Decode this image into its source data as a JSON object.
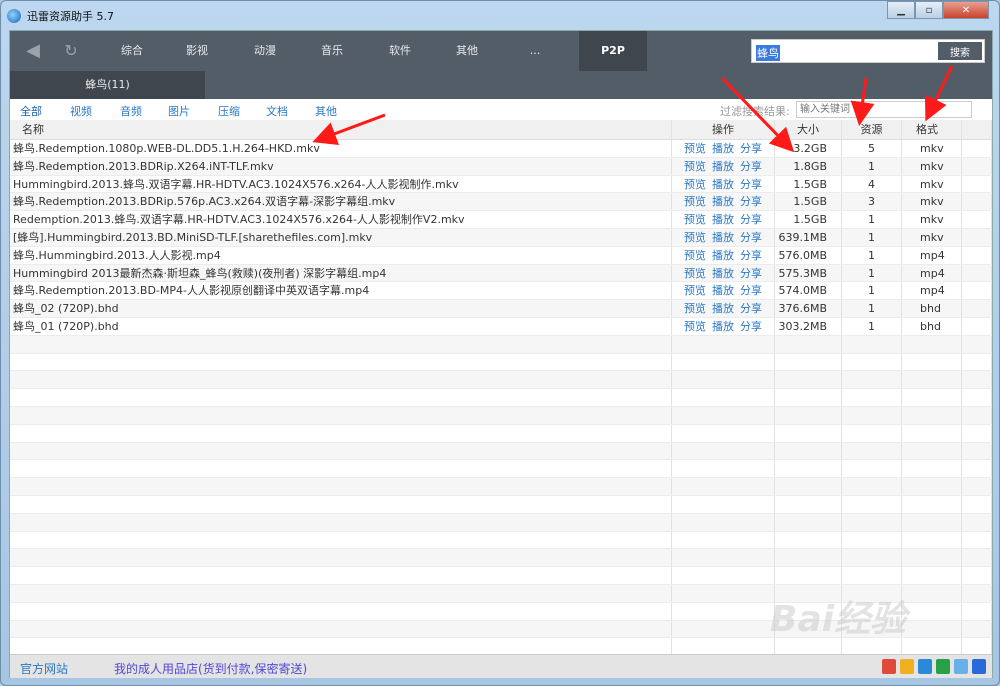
{
  "window": {
    "title": "迅雷资源助手 5.7",
    "minimize": "▁",
    "maximize": "▫",
    "close": "✕"
  },
  "toolbar": {
    "back_icon": "back-arrow-icon",
    "refresh_icon": "refresh-icon",
    "nav": [
      "综合",
      "影视",
      "动漫",
      "音乐",
      "软件",
      "其他",
      "..."
    ],
    "active": "P2P",
    "search_value": "蜂鸟",
    "search_button": "搜索"
  },
  "subtab": "蜂鸟(11)",
  "categories": [
    "全部",
    "视频",
    "音频",
    "图片",
    "压缩",
    "文档",
    "其他"
  ],
  "filter": {
    "label": "过滤搜索结果:",
    "placeholder": "输入关键词"
  },
  "columns": [
    "名称",
    "操作",
    "大小",
    "资源",
    "格式"
  ],
  "ops": [
    "预览",
    "播放",
    "分享"
  ],
  "rows": [
    [
      "蜂鸟.Redemption.1080p.WEB-DL.DD5.1.H.264-HKD.mkv",
      "3.2GB",
      "5",
      "mkv"
    ],
    [
      "蜂鸟.Redemption.2013.BDRip.X264.iNT-TLF.mkv",
      "1.8GB",
      "1",
      "mkv"
    ],
    [
      "Hummingbird.2013.蜂鸟.双语字幕.HR-HDTV.AC3.1024X576.x264-人人影视制作.mkv",
      "1.5GB",
      "4",
      "mkv"
    ],
    [
      "蜂鸟.Redemption.2013.BDRip.576p.AC3.x264.双语字幕-深影字幕组.mkv",
      "1.5GB",
      "3",
      "mkv"
    ],
    [
      "Redemption.2013.蜂鸟.双语字幕.HR-HDTV.AC3.1024X576.x264-人人影视制作V2.mkv",
      "1.5GB",
      "1",
      "mkv"
    ],
    [
      "[蜂鸟].Hummingbird.2013.BD.MiniSD-TLF.[sharethefiles.com].mkv",
      "639.1MB",
      "1",
      "mkv"
    ],
    [
      "蜂鸟.Hummingbird.2013.人人影视.mp4",
      "576.0MB",
      "1",
      "mp4"
    ],
    [
      "Hummingbird 2013最新杰森·斯坦森_蜂鸟(救赎)(夜刑者) 深影字幕组.mp4",
      "575.3MB",
      "1",
      "mp4"
    ],
    [
      "蜂鸟.Redemption.2013.BD-MP4-人人影视原创翻译中英双语字幕.mp4",
      "574.0MB",
      "1",
      "mp4"
    ],
    [
      "蜂鸟_02 (720P).bhd",
      "376.6MB",
      "1",
      "bhd"
    ],
    [
      "蜂鸟_01 (720P).bhd",
      "303.2MB",
      "1",
      "bhd"
    ]
  ],
  "status": {
    "official_site": "官方网站",
    "shop_link": "我的成人用品店(货到付款,保密寄送)",
    "icon_colors": [
      "#e04a3a",
      "#f0b020",
      "#2a8ad8",
      "#28a048",
      "#6ab0e8",
      "#2a6ad8"
    ]
  },
  "colors": {
    "toolbar": "#535d68",
    "link": "#2b78c5",
    "annotation": "#ff1a1a"
  }
}
